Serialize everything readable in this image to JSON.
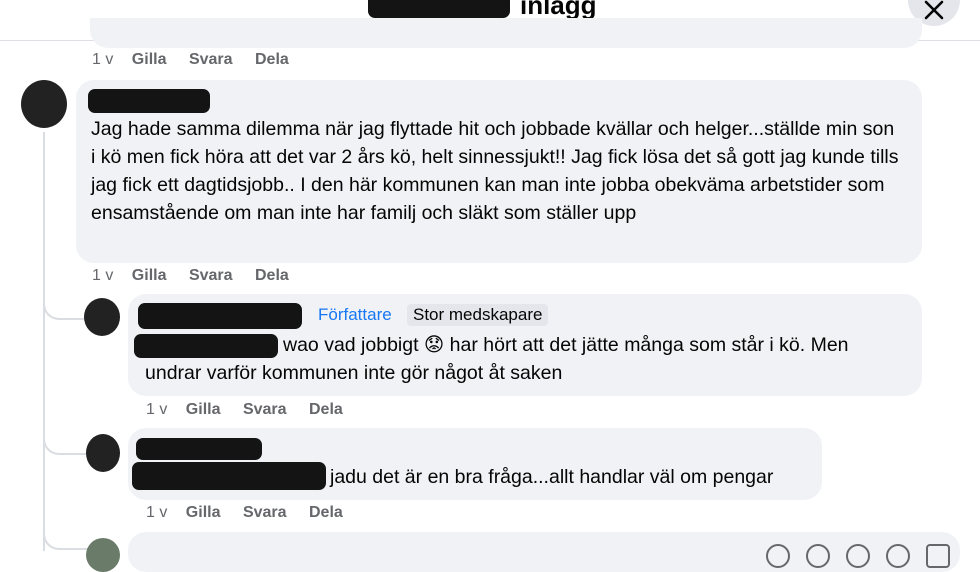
{
  "header": {
    "title": "inlägg"
  },
  "comments": [
    {
      "actions": {
        "age": "1 v",
        "like": "Gilla",
        "reply": "Svara",
        "share": "Dela"
      }
    },
    {
      "text": "Jag hade samma dilemma när jag flyttade hit och jobbade kvällar och helger...ställde min son i kö men fick höra att det var 2 års kö, helt sinnessjukt!! Jag fick lösa det så gott jag kunde tills jag fick ett dagtidsjobb.. I den här kommunen kan man inte jobba obekväma arbetstider som ensamstående om man inte har familj och släkt som ställer upp",
      "actions": {
        "age": "1 v",
        "like": "Gilla",
        "reply": "Svara",
        "share": "Dela"
      }
    },
    {
      "badges": {
        "author": "Författare",
        "cocreator": "Stor medskapare"
      },
      "text_line1": "wao vad jobbigt 😟 har hört att det jätte många som står i kö. Men",
      "text_line2": "undrar varför kommunen inte gör något åt saken",
      "actions": {
        "age": "1 v",
        "like": "Gilla",
        "reply": "Svara",
        "share": "Dela"
      }
    },
    {
      "text": "jadu det är en bra fråga...allt handlar väl om pengar",
      "actions": {
        "age": "1 v",
        "like": "Gilla",
        "reply": "Svara",
        "share": "Dela"
      }
    }
  ],
  "colors": {
    "author_badge": "#1877f2",
    "bubble": "#f0f2f5",
    "meta": "#65676b"
  },
  "icons": [
    "close-icon",
    "emoji-icon",
    "camera-icon",
    "gif-icon",
    "sticker-icon",
    "send-icon"
  ]
}
